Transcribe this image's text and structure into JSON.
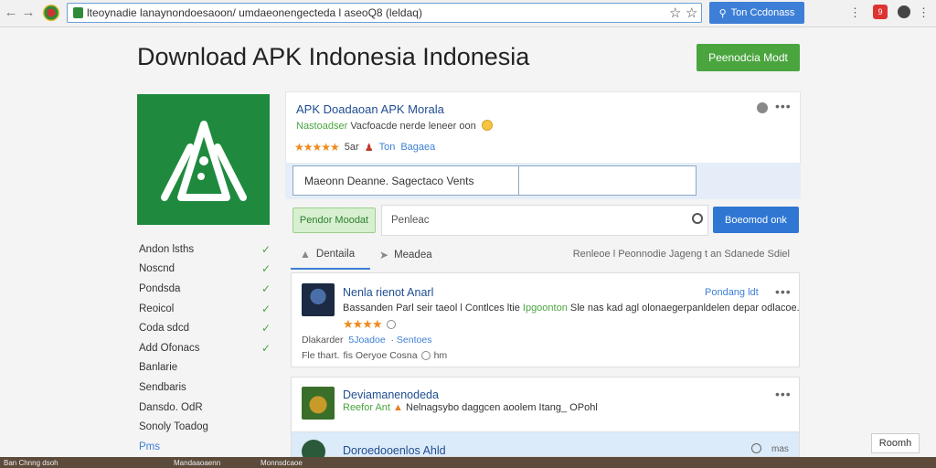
{
  "browser": {
    "url": "lteoynadie lanaynondoesaoon/ umdaeonengecteda l aseoQ8 (leldaq)",
    "sign_in_label": "Ton Ccdonass",
    "notification_count": "9"
  },
  "page": {
    "title": "Download APK Indonesia Indonesia",
    "cta_label": "Peenodcia Modt"
  },
  "sidebar": {
    "items": [
      {
        "label": "Andon lsths",
        "checked": true
      },
      {
        "label": "Noscnd",
        "checked": true
      },
      {
        "label": "Pondsda",
        "checked": true
      },
      {
        "label": "Reoicol",
        "checked": true
      },
      {
        "label": "Coda sdcd",
        "checked": true
      },
      {
        "label": "Add Ofonacs",
        "checked": true
      },
      {
        "label": "Banlarie",
        "checked": false
      },
      {
        "label": "Sendbaris",
        "checked": false
      },
      {
        "label": "Dansdo. OdR",
        "checked": false
      },
      {
        "label": "Sonoly Toadog",
        "checked": false
      },
      {
        "label": "Pms",
        "checked": false,
        "link": true
      }
    ]
  },
  "app_card": {
    "title": "APK Doadaoan APK Morala",
    "tag": "Nastoadser",
    "subtitle": "Vacfoacde nerde leneer oon",
    "rating_label": "5ar",
    "rating_stars": 4.5,
    "link1": "Ton",
    "link2": "Bagaea"
  },
  "search": {
    "field_a_value": "Maeonn Deanne.  Sagectaco Vents",
    "filter_label": "Pendor Moodat",
    "query_placeholder": "Penleac",
    "search_button": "Boeomod onk"
  },
  "tabs": [
    {
      "label": "Dentaila"
    },
    {
      "label": "Meadea"
    }
  ],
  "tab_note": "Renleoe l Peonnodie Jageng t an Sdanede Sdiel",
  "results": [
    {
      "title": "Nenla rienot Anarl",
      "link": "Pondang ldt",
      "desc_before": "Bassanden Parl seir taeol l Contlces ltie ",
      "desc_highlight": "Ipgoonton",
      "desc_after": " Sle nas kad agl olonaegerpanldelen depar odlacoe.",
      "stars": 4,
      "meta1_label": "Dlakarder",
      "meta1_link1": "5Joadoe",
      "meta1_link2": "Sentoes",
      "meta2_a": "Fle thart.",
      "meta2_b": "fis Oeryoe  Cosna",
      "meta2_c": "hm"
    },
    {
      "title": "Deviamanenodeda",
      "desc_highlight": "Reefor Ant",
      "desc_after": "Nelnagsybo daggcen aoolem Itang_ OPohl"
    },
    {
      "title": "Doroedooenlos Ahld",
      "more_label": "mas"
    }
  ],
  "pager_label": "Roomh",
  "taskbar": {
    "items": [
      "Ban Chnng dsoh",
      "Mandaaoaenn",
      "Monnsdcaoe"
    ]
  }
}
